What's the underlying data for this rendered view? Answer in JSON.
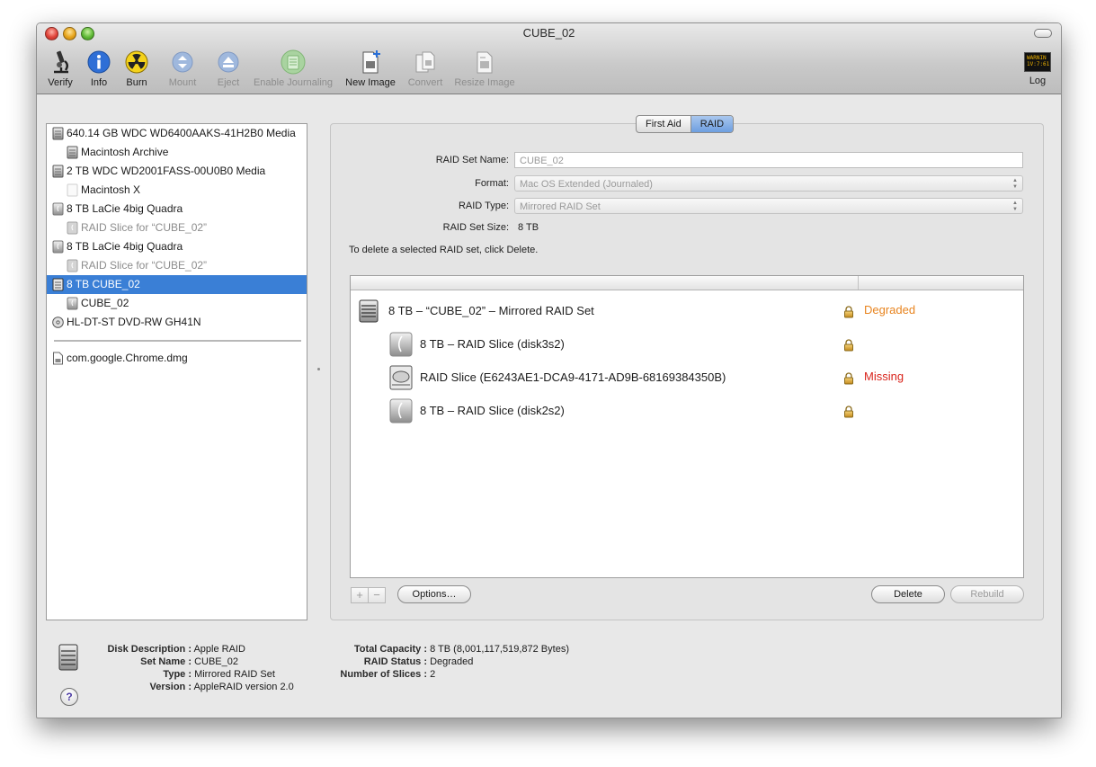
{
  "window": {
    "title": "CUBE_02"
  },
  "toolbar": {
    "verify": "Verify",
    "info": "Info",
    "burn": "Burn",
    "mount": "Mount",
    "eject": "Eject",
    "enable_journaling": "Enable Journaling",
    "new_image": "New Image",
    "convert": "Convert",
    "resize_image": "Resize Image",
    "log": "Log",
    "log_icon_text": "WARNIN\n1V:7:61"
  },
  "sidebar": {
    "items": [
      {
        "label": "640.14 GB WDC WD6400AAKS-41H2B0 Media",
        "icon": "internal-disk-icon"
      },
      {
        "label": "Macintosh Archive",
        "icon": "volume-icon"
      },
      {
        "label": "2 TB WDC WD2001FASS-00U0B0 Media",
        "icon": "internal-disk-icon"
      },
      {
        "label": "Macintosh X",
        "icon": "blank-volume-icon"
      },
      {
        "label": "8 TB LaCie    4big Quadra",
        "icon": "external-disk-icon"
      },
      {
        "label": "RAID Slice for “CUBE_02”",
        "icon": "raid-slice-icon"
      },
      {
        "label": "8 TB LaCie    4big Quadra",
        "icon": "external-disk-icon"
      },
      {
        "label": "RAID Slice for “CUBE_02”",
        "icon": "raid-slice-icon"
      },
      {
        "label": "8 TB CUBE_02",
        "icon": "raid-set-icon"
      },
      {
        "label": "CUBE_02",
        "icon": "volume-icon"
      },
      {
        "label": "HL-DT-ST DVD-RW GH41N",
        "icon": "optical-drive-icon"
      },
      {
        "label": "com.google.Chrome.dmg",
        "icon": "disk-image-icon"
      }
    ]
  },
  "tabs": {
    "first_aid": "First Aid",
    "raid": "RAID"
  },
  "form": {
    "set_name_label": "RAID Set Name:",
    "set_name_value": "CUBE_02",
    "format_label": "Format:",
    "format_value": "Mac OS Extended (Journaled)",
    "type_label": "RAID Type:",
    "type_value": "Mirrored RAID Set",
    "size_label": "RAID Set Size:",
    "size_value": "8 TB",
    "hint": "To delete a selected RAID set, click Delete."
  },
  "raid_table": {
    "rows": [
      {
        "label": "8 TB – “CUBE_02” – Mirrored RAID Set",
        "status": "Degraded",
        "status_color": "#e8841f"
      },
      {
        "label": "8 TB – RAID Slice (disk3s2)",
        "status": "",
        "status_color": "#000000"
      },
      {
        "label": "RAID Slice (E6243AE1-DCA9-4171-AD9B-68169384350B)",
        "status": "Missing",
        "status_color": "#d9241c"
      },
      {
        "label": "8 TB – RAID Slice (disk2s2)",
        "status": "",
        "status_color": "#000000"
      }
    ]
  },
  "buttons": {
    "plus": "+",
    "minus": "−",
    "options": "Options…",
    "delete": "Delete",
    "rebuild": "Rebuild"
  },
  "info": {
    "disk_description_label": "Disk Description :",
    "disk_description": "Apple RAID",
    "set_name_label": "Set Name :",
    "set_name": "CUBE_02",
    "type_label": "Type :",
    "type": "Mirrored RAID Set",
    "version_label": "Version :",
    "version": "AppleRAID version 2.0",
    "total_capacity_label": "Total Capacity :",
    "total_capacity": "8 TB (8,001,117,519,872 Bytes)",
    "raid_status_label": "RAID Status :",
    "raid_status": "Degraded",
    "number_of_slices_label": "Number of Slices :",
    "number_of_slices": "2",
    "help": "?"
  },
  "colors": {
    "selection": "#3a7fd6",
    "degraded": "#e8841f",
    "missing": "#d9241c"
  }
}
